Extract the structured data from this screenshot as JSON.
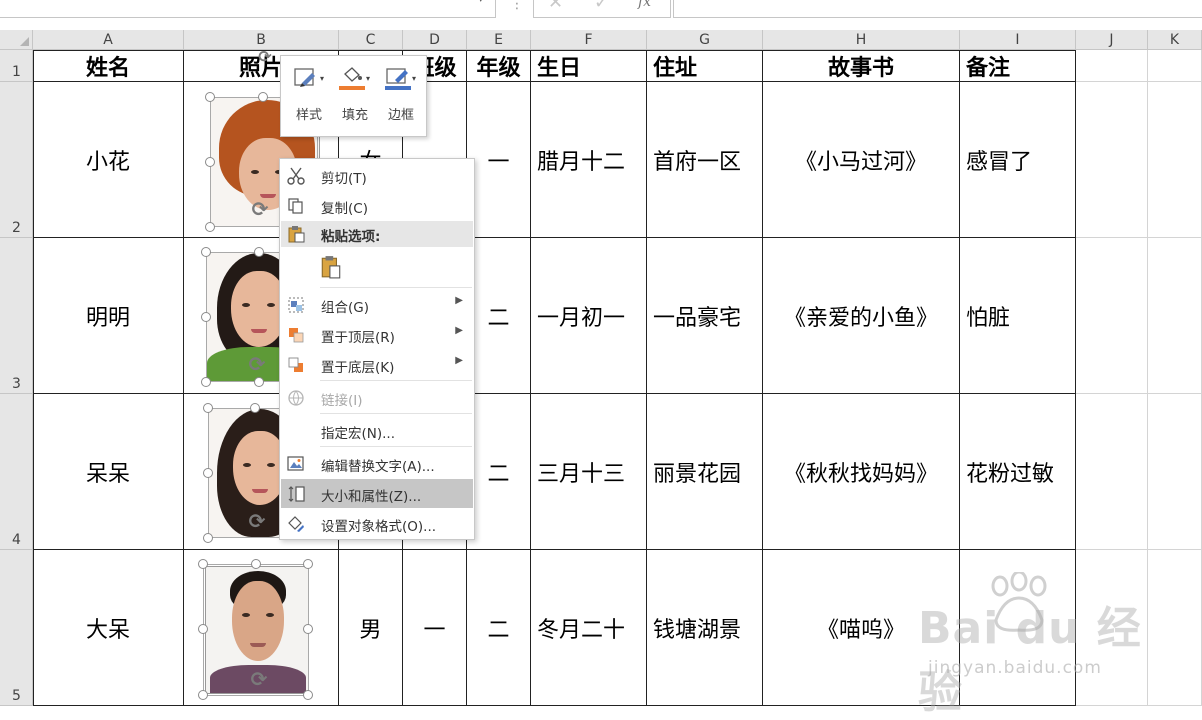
{
  "formula_bar": {
    "fx_label": "fx"
  },
  "columns": [
    "A",
    "B",
    "C",
    "D",
    "E",
    "F",
    "G",
    "H",
    "I",
    "J",
    "K"
  ],
  "rows": [
    "1",
    "2",
    "3",
    "4",
    "5"
  ],
  "headers": {
    "name": "姓名",
    "photo_partial": "照片",
    "class_partial": "班级",
    "grade": "年级",
    "birthday": "生日",
    "address": "住址",
    "storybook": "故事书",
    "note": "备注"
  },
  "records": [
    {
      "name": "小花",
      "gender": "女",
      "grade": "一",
      "birthday": "腊月十二",
      "address": "首府一区",
      "storybook": "《小马过河》",
      "note": "感冒了"
    },
    {
      "name": "明明",
      "grade": "二",
      "birthday": "一月初一",
      "address": "一品豪宅",
      "storybook": "《亲爱的小鱼》",
      "note": "怕脏"
    },
    {
      "name": "呆呆",
      "grade": "二",
      "birthday": "三月十三",
      "address": "丽景花园",
      "storybook": "《秋秋找妈妈》",
      "note": "花粉过敏"
    },
    {
      "name": "大呆",
      "gender": "男",
      "class": "一",
      "grade": "二",
      "birthday": "冬月二十",
      "address": "钱塘湖景",
      "storybook": "《喵呜》",
      "note": ""
    }
  ],
  "mini_toolbar": [
    {
      "label": "样式",
      "icon": "style-icon",
      "color": "#5b7fbd"
    },
    {
      "label": "填充",
      "icon": "fill-bucket-icon",
      "color": "#ed7d31"
    },
    {
      "label": "边框",
      "icon": "outline-pen-icon",
      "color": "#4472c4"
    }
  ],
  "context_menu": {
    "cut": "剪切(T)",
    "copy": "复制(C)",
    "paste_options": "粘贴选项:",
    "group": "组合(G)",
    "bring_front": "置于顶层(R)",
    "send_back": "置于底层(K)",
    "link": "链接(I)",
    "assign_macro": "指定宏(N)...",
    "edit_alt_text": "编辑替换文字(A)...",
    "size_properties": "大小和属性(Z)...",
    "format_object": "设置对象格式(O)..."
  },
  "watermark": {
    "logo": "Bai du 经验",
    "url": "jingyan.baidu.com"
  }
}
